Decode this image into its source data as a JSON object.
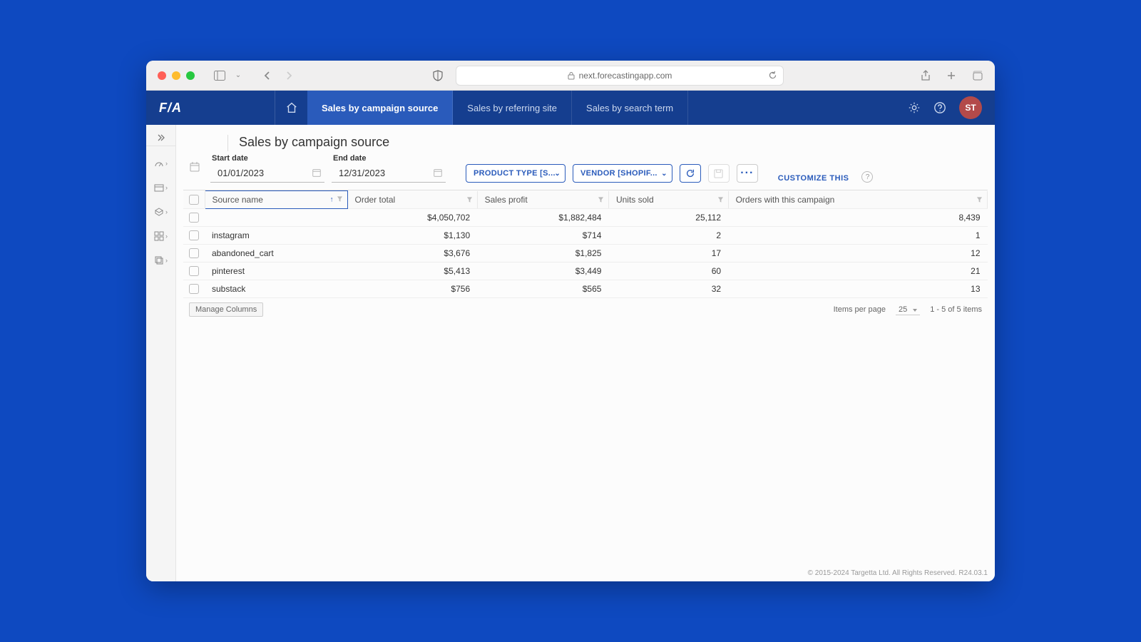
{
  "browser": {
    "url": "next.forecastingapp.com"
  },
  "header": {
    "logo": "F/A",
    "tabs": [
      {
        "label": "Sales by campaign source",
        "active": true
      },
      {
        "label": "Sales by referring site",
        "active": false
      },
      {
        "label": "Sales by search term",
        "active": false
      }
    ],
    "avatar": "ST"
  },
  "page": {
    "title": "Sales by campaign source",
    "start_date_label": "Start date",
    "start_date": "01/01/2023",
    "end_date_label": "End date",
    "end_date": "12/31/2023",
    "filter_product": "PRODUCT TYPE [S...",
    "filter_vendor": "VENDOR [SHOPIF...",
    "customize": "CUSTOMIZE THIS"
  },
  "table": {
    "columns": [
      "Source name",
      "Order total",
      "Sales profit",
      "Units sold",
      "Orders with this campaign"
    ],
    "rows": [
      {
        "source": "",
        "order_total": "$4,050,702",
        "sales_profit": "$1,882,484",
        "units_sold": "25,112",
        "orders": "8,439"
      },
      {
        "source": "instagram",
        "order_total": "$1,130",
        "sales_profit": "$714",
        "units_sold": "2",
        "orders": "1"
      },
      {
        "source": "abandoned_cart",
        "order_total": "$3,676",
        "sales_profit": "$1,825",
        "units_sold": "17",
        "orders": "12"
      },
      {
        "source": "pinterest",
        "order_total": "$5,413",
        "sales_profit": "$3,449",
        "units_sold": "60",
        "orders": "21"
      },
      {
        "source": "substack",
        "order_total": "$756",
        "sales_profit": "$565",
        "units_sold": "32",
        "orders": "13"
      }
    ]
  },
  "footer": {
    "manage_columns": "Manage Columns",
    "items_per_page_label": "Items per page",
    "items_per_page": "25",
    "range": "1 - 5 of 5 items"
  },
  "copyright": "© 2015-2024 Targetta Ltd. All Rights Reserved. R24.03.1"
}
